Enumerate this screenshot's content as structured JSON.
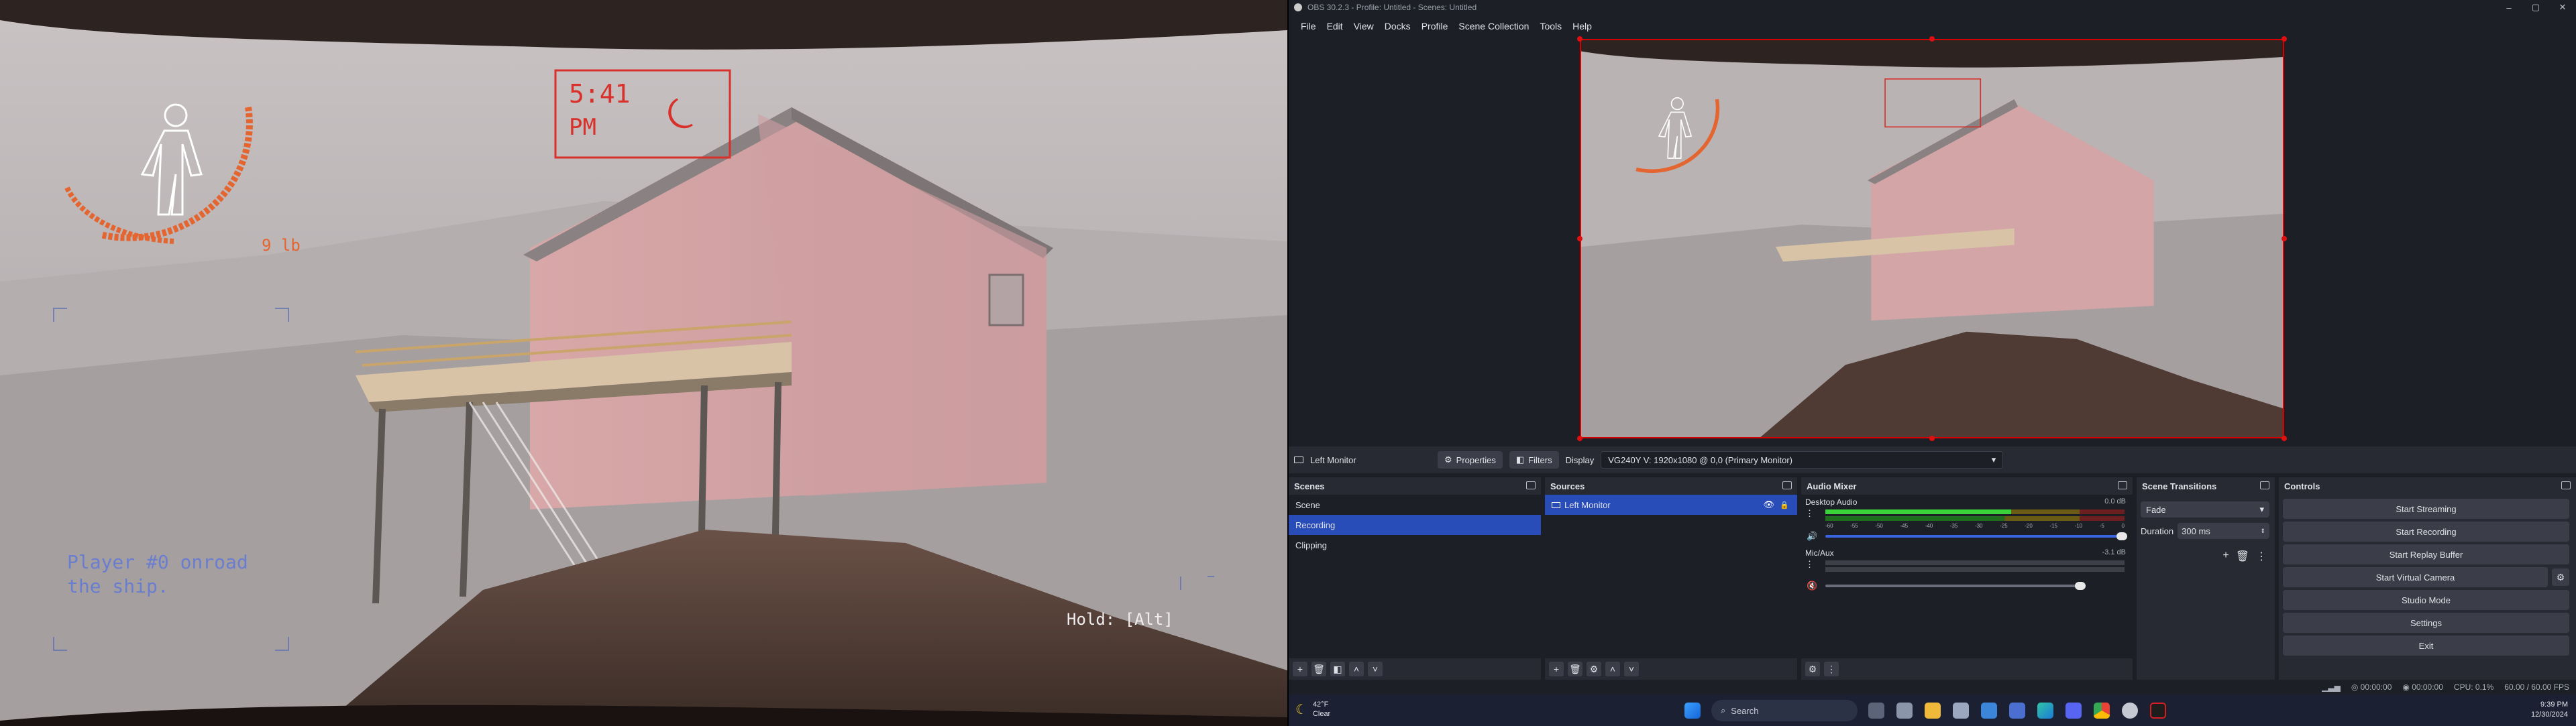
{
  "game": {
    "clock_time": "5:41",
    "clock_ampm": "PM",
    "weight": "9 lb",
    "player_message_line1": "Player #0 onroad",
    "player_message_line2": "the ship.",
    "hold_hint": "Hold: [Alt]"
  },
  "obs": {
    "title": "OBS 30.2.3 - Profile: Untitled - Scenes: Untitled",
    "menu": [
      "File",
      "Edit",
      "View",
      "Docks",
      "Profile",
      "Scene Collection",
      "Tools",
      "Help"
    ],
    "context": {
      "source_name": "Left Monitor",
      "properties": "Properties",
      "filters": "Filters",
      "display_label": "Display",
      "display_value": "VG240Y V: 1920x1080 @ 0,0 (Primary Monitor)"
    },
    "scenes": {
      "title": "Scenes",
      "items": [
        "Scene",
        "Recording",
        "Clipping"
      ],
      "selected_index": 1
    },
    "sources": {
      "title": "Sources",
      "items": [
        "Left Monitor"
      ]
    },
    "audio": {
      "title": "Audio Mixer",
      "channels": [
        {
          "name": "Desktop Audio",
          "db": "0.0 dB",
          "level": 0.62
        },
        {
          "name": "Mic/Aux",
          "db": "-3.1 dB",
          "level": 0.0
        }
      ],
      "scale": [
        "-60",
        "-55",
        "-50",
        "-45",
        "-40",
        "-35",
        "-30",
        "-25",
        "-20",
        "-15",
        "-10",
        "-5",
        "0"
      ]
    },
    "transitions": {
      "title": "Scene Transitions",
      "type": "Fade",
      "duration_label": "Duration",
      "duration_value": "300 ms"
    },
    "controls": {
      "title": "Controls",
      "buttons": [
        "Start Streaming",
        "Start Recording",
        "Start Replay Buffer",
        "Start Virtual Camera",
        "Studio Mode",
        "Settings",
        "Exit"
      ]
    },
    "status": {
      "rec_time": "00:00:00",
      "stream_time": "00:00:00",
      "cpu": "CPU: 0.1%",
      "fps": "60.00 / 60.00 FPS"
    }
  },
  "taskbar": {
    "weather_temp": "42°F",
    "weather_desc": "Clear",
    "search_placeholder": "Search",
    "time": "9:39 PM",
    "date": "12/30/2024"
  },
  "colors": {
    "hud_orange": "#e4652f",
    "hud_red": "#d8302a",
    "obs_accent": "#284cb8",
    "preview_border": "#d80000"
  }
}
